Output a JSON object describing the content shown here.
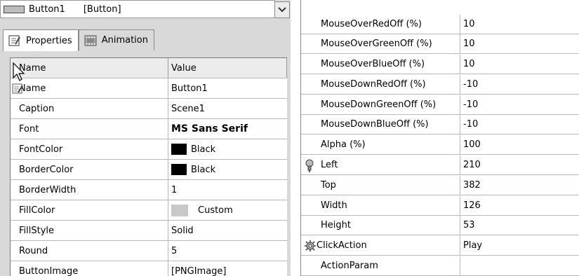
{
  "selector": {
    "name": "Button1",
    "type": "[Button]"
  },
  "tabs": [
    {
      "label": "Properties",
      "icon": "properties-icon",
      "active": true
    },
    {
      "label": "Animation",
      "icon": "animation-icon",
      "active": false
    }
  ],
  "left_grid": {
    "headers": [
      "Name",
      "Value"
    ],
    "rows": [
      {
        "name": "Name",
        "value": "Button1"
      },
      {
        "name": "Caption",
        "value": "Scene1"
      },
      {
        "name": "Font",
        "value": "MS Sans Serif"
      },
      {
        "name": "FontColor",
        "value": "Black",
        "swatch": "#000000"
      },
      {
        "name": "BorderColor",
        "value": "Black",
        "swatch": "#000000"
      },
      {
        "name": "BorderWidth",
        "value": "1"
      },
      {
        "name": "FillColor",
        "value": "Custom",
        "swatch": "#c8c8c8"
      },
      {
        "name": "FillStyle",
        "value": "Solid"
      },
      {
        "name": "Round",
        "value": "5"
      },
      {
        "name": "ButtonImage",
        "value": "[PNGImage]"
      }
    ]
  },
  "right_grid": {
    "rows": [
      {
        "name": "MouseOverRedOff (%)",
        "value": "10"
      },
      {
        "name": "MouseOverGreenOff (%)",
        "value": "10"
      },
      {
        "name": "MouseOverBlueOff (%)",
        "value": "10"
      },
      {
        "name": "MouseDownRedOff (%)",
        "value": "-10"
      },
      {
        "name": "MouseDownGreenOff (%)",
        "value": "-10"
      },
      {
        "name": "MouseDownBlueOff (%)",
        "value": "-10"
      },
      {
        "name": "Alpha (%)",
        "value": "100"
      },
      {
        "name": "Left",
        "value": "210",
        "icon": "pin-icon"
      },
      {
        "name": "Top",
        "value": "382"
      },
      {
        "name": "Width",
        "value": "126"
      },
      {
        "name": "Height",
        "value": "53"
      },
      {
        "name": "ClickAction",
        "value": "Play",
        "icon": "gear-icon"
      },
      {
        "name": "ActionParam",
        "value": ""
      }
    ]
  }
}
